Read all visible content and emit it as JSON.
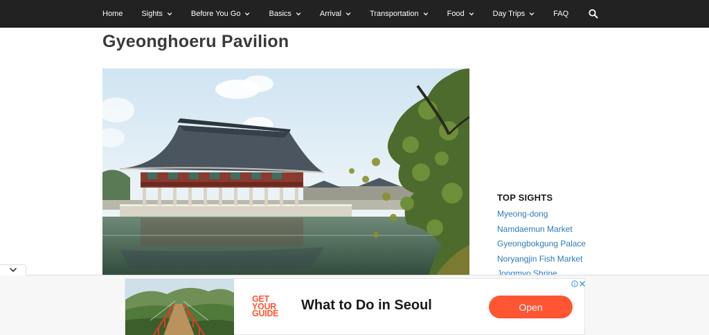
{
  "nav": {
    "items": [
      {
        "label": "Home",
        "has_dropdown": false
      },
      {
        "label": "Sights",
        "has_dropdown": true
      },
      {
        "label": "Before You Go",
        "has_dropdown": true
      },
      {
        "label": "Basics",
        "has_dropdown": true
      },
      {
        "label": "Arrival",
        "has_dropdown": true
      },
      {
        "label": "Transportation",
        "has_dropdown": true
      },
      {
        "label": "Food",
        "has_dropdown": true
      },
      {
        "label": "Day Trips",
        "has_dropdown": true
      },
      {
        "label": "FAQ",
        "has_dropdown": false
      }
    ],
    "search_icon": "search-icon",
    "background": "#222222"
  },
  "page": {
    "title": "Gyeonghoeru Pavilion",
    "hero_image": "gyeonghoeru-pavilion-photo"
  },
  "sidebar": {
    "heading": "TOP SIGHTS",
    "links": [
      "Myeong-dong",
      "Namdaemun Market",
      "Gyeongbokgung Palace",
      "Noryangjin Fish Market",
      "Jongmyo Shrine"
    ],
    "link_color": "#2d7bb8"
  },
  "collapse": {
    "icon": "chevron-down-icon"
  },
  "ad": {
    "logo": [
      "GET",
      "YOUR",
      "GUIDE"
    ],
    "headline": "What to Do in Seoul",
    "cta": "Open",
    "brand_color": "#ff5533",
    "info_icon": "info-icon",
    "close_icon": "close-icon"
  }
}
